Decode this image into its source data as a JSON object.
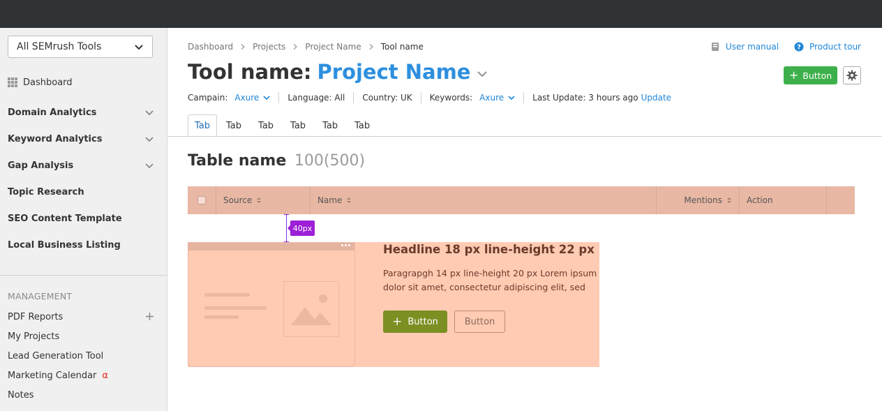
{
  "sidebar": {
    "tool_select": "All SEMrush Tools",
    "dashboard": "Dashboard",
    "groups": [
      {
        "label": "Domain Analytics",
        "expandable": true
      },
      {
        "label": "Keyword Analytics",
        "expandable": true
      },
      {
        "label": "Gap Analysis",
        "expandable": true
      },
      {
        "label": "Topic Research",
        "expandable": false
      },
      {
        "label": "SEO Content Template",
        "expandable": false
      },
      {
        "label": "Local Business Listing",
        "expandable": false
      }
    ],
    "management_title": "MANAGEMENT",
    "management_items": [
      {
        "label": "PDF Reports"
      },
      {
        "label": "My Projects"
      },
      {
        "label": "Lead Generation Tool"
      },
      {
        "label": "Marketing Calendar",
        "badge": "α"
      },
      {
        "label": "Notes"
      }
    ]
  },
  "breadcrumb": [
    "Dashboard",
    "Projects",
    "Project Name",
    "Tool name"
  ],
  "top_links": {
    "user_manual": "User manual",
    "product_tour": "Product tour"
  },
  "title": {
    "tool": "Tool name:",
    "project": "Project Name"
  },
  "header_button": "Button",
  "filters": {
    "campaign_label": "Campain:",
    "campaign_value": "Axure",
    "language": "Language: All",
    "country": "Country: UK",
    "keywords_label": "Keywords:",
    "keywords_value": "Axure",
    "last_update": "Last Update: 3 hours ago",
    "update_link": "Update"
  },
  "tabs": [
    "Tab",
    "Tab",
    "Tab",
    "Tab",
    "Tab",
    "Tab"
  ],
  "table": {
    "title": "Table name",
    "count": "100(500)",
    "columns": [
      "Source",
      "Name",
      "Mentions",
      "Action"
    ]
  },
  "spacer_label": "40px",
  "card": {
    "headline": "Headline 18 px line-height 22 px",
    "paragraph": "Paragrapgh 14 px line-height 20 px Lorem ipsum dolor sit amet, consectetur adipiscing elit, sed",
    "primary_button": "Button",
    "secondary_button": "Button"
  },
  "colors": {
    "topbar": "#2f3336",
    "accent_blue": "#2d8fde",
    "green_button": "#3eb04b",
    "table_header": "#e8b8a4",
    "card_bg": "#ffcbb3",
    "card_primary_button": "#7c8f23",
    "spacer_marker": "#9d1fd6"
  }
}
